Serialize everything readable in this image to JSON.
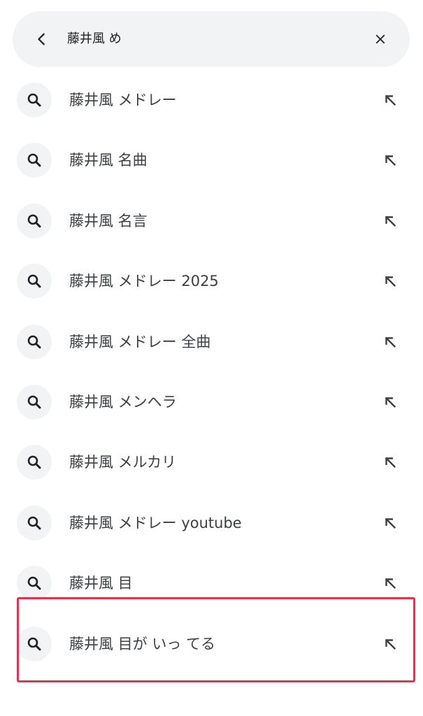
{
  "search_bar": {
    "query": "藤井風 め",
    "back_icon": "chevron-left-icon",
    "clear_icon": "close-icon"
  },
  "suggestions": [
    {
      "label": "藤井風 メドレー"
    },
    {
      "label": "藤井風 名曲"
    },
    {
      "label": "藤井風 名言"
    },
    {
      "label": "藤井風 メドレー 2025"
    },
    {
      "label": "藤井風 メドレー 全曲"
    },
    {
      "label": "藤井風 メンヘラ"
    },
    {
      "label": "藤井風 メルカリ"
    },
    {
      "label": "藤井風 メドレー youtube"
    },
    {
      "label": "藤井風 目"
    },
    {
      "label": "藤井風 目が いっ てる"
    }
  ],
  "icons": {
    "suggestion_leading": "search-icon",
    "suggestion_trailing": "arrow-up-left-icon"
  },
  "colors": {
    "search_bar_bg": "#f1f3f4",
    "icon_circle_bg": "#f1f3f4",
    "highlight_border": "#e8304f",
    "text": "#3c4043"
  },
  "highlighted_index": 9
}
